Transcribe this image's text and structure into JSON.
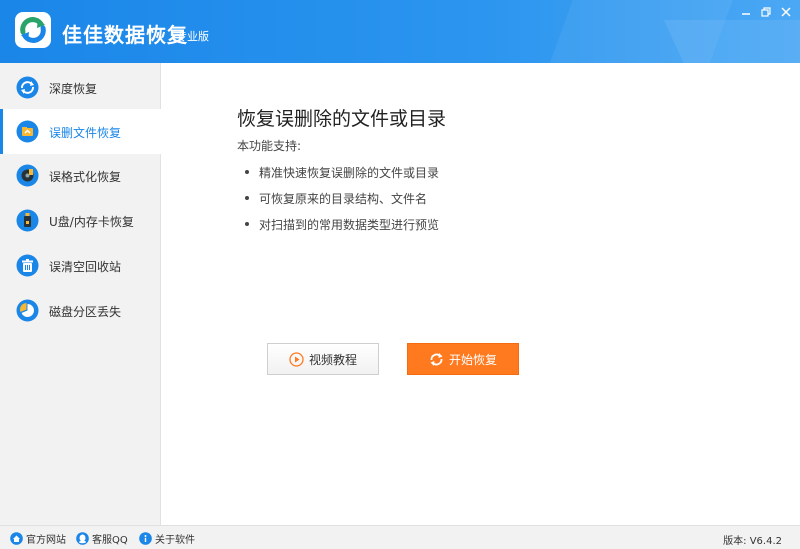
{
  "app": {
    "title": "佳佳数据恢复",
    "edition": "专业版"
  },
  "sidebar": {
    "items": [
      {
        "label": "深度恢复",
        "icon": "refresh-icon"
      },
      {
        "label": "误删文件恢复",
        "icon": "folder-restore-icon",
        "active": true
      },
      {
        "label": "误格式化恢复",
        "icon": "disk-icon"
      },
      {
        "label": "U盘/内存卡恢复",
        "icon": "usb-drive-icon"
      },
      {
        "label": "误清空回收站",
        "icon": "recycle-bin-icon"
      },
      {
        "label": "磁盘分区丢失",
        "icon": "pie-partition-icon"
      }
    ]
  },
  "main": {
    "title": "恢复误删除的文件或目录",
    "support_title": "本功能支持:",
    "features": [
      "精准快速恢复误删除的文件或目录",
      "可恢复原来的目录结构、文件名",
      "对扫描到的常用数据类型进行预览"
    ],
    "video_button": "视频教程",
    "start_button": "开始恢复"
  },
  "statusbar": {
    "website": "官方网站",
    "support_qq": "客服QQ",
    "about": "关于软件",
    "version": "版本: V6.4.2"
  },
  "colors": {
    "accent": "#1a86e8",
    "start_button": "#ff7a1f",
    "sidebar_bg": "#f2f2f2"
  }
}
